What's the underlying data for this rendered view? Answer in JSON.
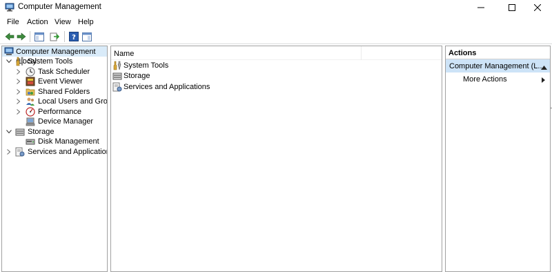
{
  "window": {
    "title": "Computer Management",
    "controls": [
      "minimize-icon",
      "maximize-icon",
      "close-icon"
    ]
  },
  "menu": {
    "items": [
      "File",
      "Action",
      "View",
      "Help"
    ]
  },
  "toolbar": {
    "buttons": [
      "back-arrow-icon",
      "forward-arrow-icon",
      "show-hide-tree-icon",
      "export-list-icon",
      "help-icon",
      "show-hide-action-pane-icon"
    ]
  },
  "tree": {
    "root": "Computer Management (Local",
    "items": [
      {
        "label": "System Tools",
        "icon": "system-tools-icon",
        "expanded": true
      },
      {
        "label": "Task Scheduler",
        "icon": "task-scheduler-icon"
      },
      {
        "label": "Event Viewer",
        "icon": "event-viewer-icon"
      },
      {
        "label": "Shared Folders",
        "icon": "shared-folders-icon"
      },
      {
        "label": "Local Users and Groups",
        "icon": "local-users-icon"
      },
      {
        "label": "Performance",
        "icon": "performance-icon"
      },
      {
        "label": "Device Manager",
        "icon": "device-manager-icon"
      },
      {
        "label": "Storage",
        "icon": "storage-icon",
        "expanded": true
      },
      {
        "label": "Disk Management",
        "icon": "disk-management-icon"
      },
      {
        "label": "Services and Applications",
        "icon": "services-icon"
      }
    ]
  },
  "content": {
    "column_header": "Name",
    "rows": [
      {
        "label": "System Tools",
        "icon": "system-tools-icon"
      },
      {
        "label": "Storage",
        "icon": "storage-icon"
      },
      {
        "label": "Services and Applications",
        "icon": "services-icon"
      }
    ]
  },
  "actions": {
    "title": "Actions",
    "section": "Computer Management (L...",
    "more_actions": "More Actions"
  },
  "colors": {
    "selection": "#d9ebf9",
    "action_section": "#cde3f7",
    "pane_border": "#a0a0a0"
  }
}
